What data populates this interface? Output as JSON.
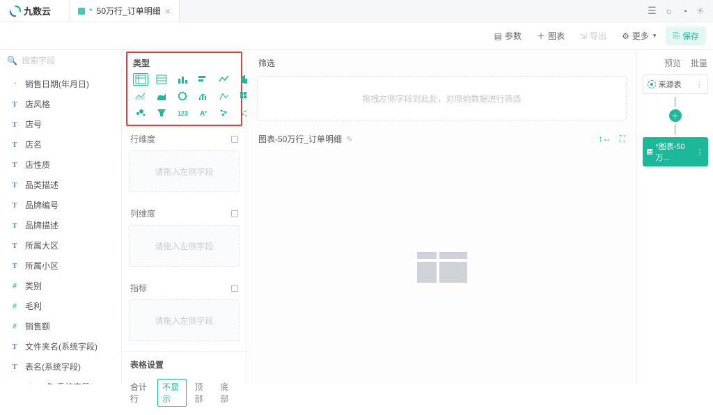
{
  "brand": {
    "name": "九数云"
  },
  "tab": {
    "title": "50万行_订单明细"
  },
  "topIcons": {
    "list": "☰",
    "bell": "○",
    "clock": "◔",
    "user": "⍟"
  },
  "toolbar": {
    "params": "参数",
    "chart": "图表",
    "export": "导出",
    "more": "更多",
    "save": "保存"
  },
  "search": {
    "placeholder": "搜索字段"
  },
  "fields": [
    {
      "type": "date",
      "label": "销售日期(年月日)"
    },
    {
      "type": "text",
      "label": "店风格"
    },
    {
      "type": "text",
      "label": "店号"
    },
    {
      "type": "text",
      "label": "店名"
    },
    {
      "type": "text",
      "label": "店性质"
    },
    {
      "type": "text",
      "label": "品类描述"
    },
    {
      "type": "text",
      "label": "品牌编号"
    },
    {
      "type": "text",
      "label": "品牌描述"
    },
    {
      "type": "text",
      "label": "所属大区"
    },
    {
      "type": "text",
      "label": "所属小区"
    },
    {
      "type": "num",
      "label": "类别"
    },
    {
      "type": "num",
      "label": "毛利"
    },
    {
      "type": "num",
      "label": "销售额"
    },
    {
      "type": "text",
      "label": "文件夹名(系统字段)"
    },
    {
      "type": "text",
      "label": "表名(系统字段)"
    },
    {
      "type": "text",
      "label": "sheet名(系统字段)"
    }
  ],
  "config": {
    "typeTitle": "类型",
    "rowDim": "行维度",
    "colDim": "列维度",
    "metric": "指标",
    "dropHint": "请拖入左侧字段",
    "tableSettings": "表格设置",
    "sumRow": "合计行",
    "seg": {
      "none": "不显示",
      "top": "顶部",
      "bottom": "底部"
    }
  },
  "canvas": {
    "filterTitle": "筛选",
    "filterHint": "拖拽左侧字段到此处，对原始数据进行筛选",
    "chartTitle": "图表-50万行_订单明细"
  },
  "pipeline": {
    "tabs": {
      "preview": "预览",
      "batch": "批量"
    },
    "sourceLabel": "来源表",
    "chartNode": "*图表-50万..."
  }
}
